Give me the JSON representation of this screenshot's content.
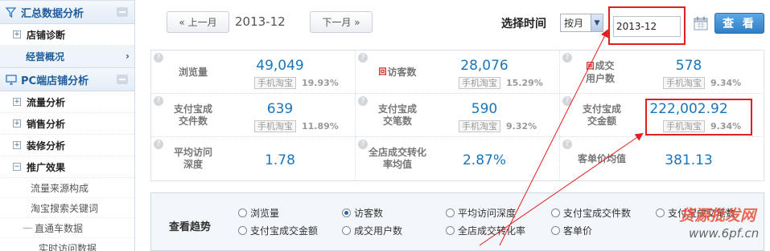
{
  "sidebar": {
    "sections": [
      {
        "title": "汇总数据分析",
        "icon": "funnel-icon"
      },
      {
        "title": "PC端店铺分析",
        "icon": "monitor-icon"
      }
    ],
    "group1_items": [
      {
        "label": "店铺诊断",
        "expander": "+"
      },
      {
        "label": "经营概况",
        "active": true,
        "arrow": "›"
      }
    ],
    "group2_items": [
      {
        "label": "流量分析",
        "expander": "+"
      },
      {
        "label": "销售分析",
        "expander": "+"
      },
      {
        "label": "装修分析",
        "expander": "+"
      },
      {
        "label": "推广效果",
        "expander": "−"
      }
    ],
    "sub_items": [
      "流量来源构成",
      "淘宝搜索关键词",
      "直通车数据",
      "实时访问数据"
    ]
  },
  "topbar": {
    "prev_label": "« 上一月",
    "next_label": "下一月 »",
    "current_date": "2013-12",
    "select_label": "选择时间",
    "period_value": "按月",
    "date_value": "2013-12",
    "view_label": "查 看"
  },
  "metrics": [
    {
      "label": "浏览量",
      "value": "49,049",
      "tag": "手机淘宝",
      "pct": "19.93%"
    },
    {
      "label": "访客数",
      "value": "28,076",
      "tag": "手机淘宝",
      "pct": "15.29%",
      "label_icon": "回"
    },
    {
      "label": "成交用户数",
      "value": "578",
      "tag": "手机淘宝",
      "pct": "9.34%",
      "label_icon": "回"
    },
    {
      "label": "支付宝成交件数",
      "value": "639",
      "tag": "手机淘宝",
      "pct": "11.89%"
    },
    {
      "label": "支付宝成交笔数",
      "value": "590",
      "tag": "手机淘宝",
      "pct": "9.32%"
    },
    {
      "label": "支付宝成交金额",
      "value": "222,002.92",
      "tag": "手机淘宝",
      "pct": "9.34%"
    },
    {
      "label": "平均访问深度",
      "value": "1.78"
    },
    {
      "label": "全店成交转化率均值",
      "value": "2.87%"
    },
    {
      "label": "客单价均值",
      "value": "381.13"
    }
  ],
  "trend": {
    "label": "查看趋势",
    "options": [
      {
        "label": "浏览量",
        "checked": false
      },
      {
        "label": "访客数",
        "checked": true
      },
      {
        "label": "平均访问深度",
        "checked": false
      },
      {
        "label": "支付宝成交件数",
        "checked": false
      },
      {
        "label": "支付宝成交笔数",
        "checked": false
      },
      {
        "label": "支付宝成交金额",
        "checked": false
      },
      {
        "label": "成交用户数",
        "checked": false
      },
      {
        "label": "全店成交转化率",
        "checked": false
      },
      {
        "label": "客单价",
        "checked": false
      }
    ]
  },
  "watermark": {
    "text1": "货源批发网",
    "text2": "www.6pf.cn"
  },
  "colors": {
    "accent": "#1a75bb",
    "highlight_box": "#e02020",
    "view_button": "#2f7fc8"
  }
}
